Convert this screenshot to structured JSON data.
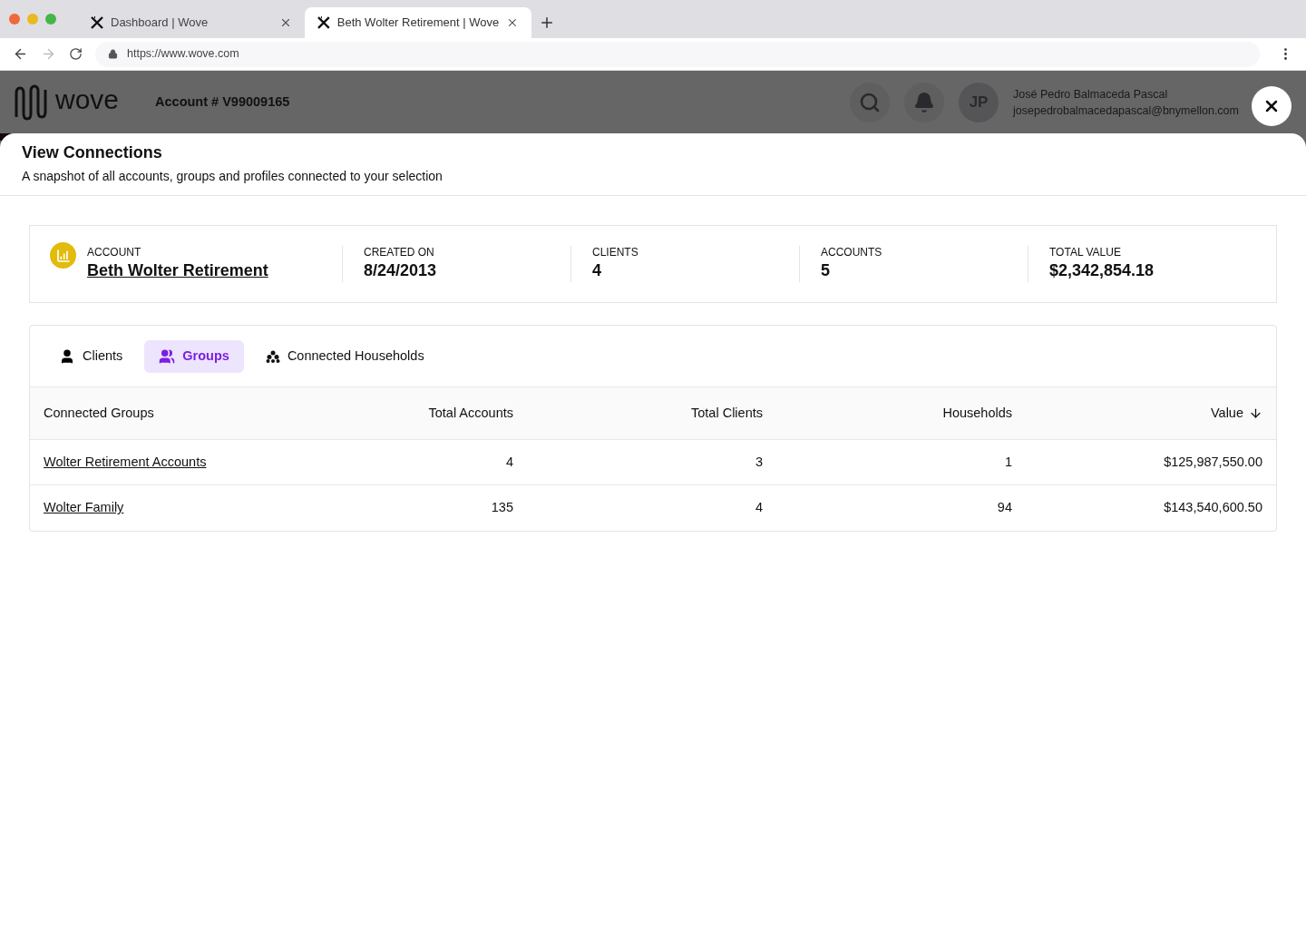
{
  "browser": {
    "tabs": [
      {
        "title": "Dashboard | Wove",
        "selected": false
      },
      {
        "title": "Beth Wolter Retirement | Wove",
        "selected": true
      }
    ],
    "url": "https://www.wove.com"
  },
  "header": {
    "logo": "wove",
    "account_number": "Account # V99009165",
    "user": {
      "initials": "JP",
      "name": "José Pedro Balmaceda Pascal",
      "email": "josepedrobalmacedapascal@bnymellon.com"
    }
  },
  "modal": {
    "title": "View Connections",
    "subtitle": "A snapshot of all accounts, groups and profiles connected to your selection",
    "summary": {
      "account_label": "ACCOUNT",
      "account_name": "Beth Wolter Retirement",
      "stats": [
        {
          "label": "CREATED ON",
          "value": "8/24/2013"
        },
        {
          "label": "CLIENTS",
          "value": "4"
        },
        {
          "label": "ACCOUNTS",
          "value": "5"
        },
        {
          "label": "TOTAL VALUE",
          "value": "$2,342,854.18"
        }
      ]
    },
    "tabs": [
      {
        "label": "Clients",
        "kind": "person",
        "selected": false
      },
      {
        "label": "Groups",
        "kind": "people",
        "selected": true
      },
      {
        "label": "Connected Households",
        "kind": "households",
        "selected": false
      }
    ],
    "table": {
      "columns": [
        {
          "label": "Connected Groups",
          "sorted": false
        },
        {
          "label": "Total Accounts",
          "sorted": false
        },
        {
          "label": "Total Clients",
          "sorted": false
        },
        {
          "label": "Households",
          "sorted": false
        },
        {
          "label": "Value",
          "sorted": true
        }
      ],
      "rows": [
        [
          "Wolter Retirement Accounts",
          "4",
          "3",
          "1",
          "$125,987,550.00"
        ],
        [
          "Wolter Family",
          "135",
          "4",
          "94",
          "$143,540,600.50"
        ]
      ]
    }
  }
}
